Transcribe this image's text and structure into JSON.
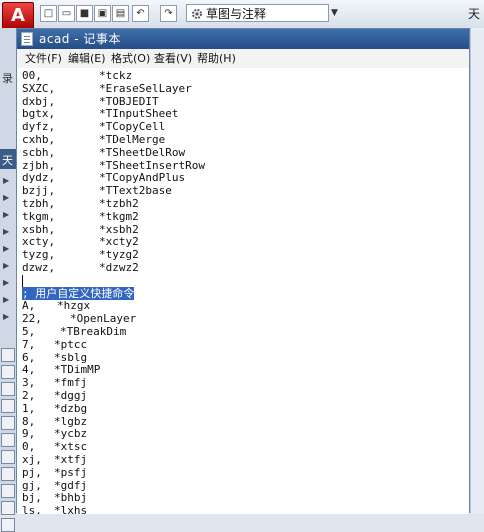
{
  "acad": {
    "logo": "A",
    "workspace": "草图与注释",
    "title_right": "天",
    "left_labels": [
      "录",
      "天"
    ]
  },
  "notepad": {
    "title": "acad - 记事本",
    "menu": [
      "文件(F)",
      "编辑(E)",
      "格式(O)",
      "查看(V)",
      "帮助(H)"
    ],
    "section1": [
      {
        "alias": "00,",
        "cmd": "*tckz"
      },
      {
        "alias": "SXZC,",
        "cmd": "*EraseSelLayer"
      },
      {
        "alias": "dxbj,",
        "cmd": "*TOBJEDIT"
      },
      {
        "alias": "bgtx,",
        "cmd": "*TInputSheet"
      },
      {
        "alias": "dyfz,",
        "cmd": "*TCopyCell"
      },
      {
        "alias": "cxhb,",
        "cmd": "*TDelMerge"
      },
      {
        "alias": "scbh,",
        "cmd": "*TSheetDelRow"
      },
      {
        "alias": "zjbh,",
        "cmd": "*TSheetInsertRow"
      },
      {
        "alias": "dydz,",
        "cmd": "*TCopyAndPlus"
      },
      {
        "alias": "bzjj,",
        "cmd": "*TText2base"
      },
      {
        "alias": "tzbh,",
        "cmd": "*tzbh2"
      },
      {
        "alias": "tkgm,",
        "cmd": "*tkgm2"
      },
      {
        "alias": "xsbh,",
        "cmd": "*xsbh2"
      },
      {
        "alias": "xcty,",
        "cmd": "*xcty2"
      },
      {
        "alias": "tyzg,",
        "cmd": "*tyzg2"
      },
      {
        "alias": "dzwz,",
        "cmd": "*dzwz2"
      }
    ],
    "comment": "; 用户自定义快捷命令",
    "section2": [
      {
        "alias": "A,",
        "cmd": "*hzgx"
      },
      {
        "alias": "22,",
        "cmd": "*OpenLayer"
      },
      {
        "alias": "5,",
        "cmd": "*TBreakDim"
      },
      {
        "alias": "7,",
        "cmd": "*ptcc"
      },
      {
        "alias": "6,",
        "cmd": "*sblg"
      },
      {
        "alias": "4,",
        "cmd": "*TDimMP"
      },
      {
        "alias": "3,",
        "cmd": "*fmfj"
      },
      {
        "alias": "2,",
        "cmd": "*dggj"
      },
      {
        "alias": "1,",
        "cmd": "*dzbg"
      },
      {
        "alias": "8,",
        "cmd": "*lgbz"
      },
      {
        "alias": "9,",
        "cmd": "*ycbz"
      },
      {
        "alias": "0,",
        "cmd": "*xtsc"
      },
      {
        "alias": "xj,",
        "cmd": "*xtfj"
      },
      {
        "alias": "pj,",
        "cmd": "*psfj"
      },
      {
        "alias": "gj,",
        "cmd": "*gdfj"
      },
      {
        "alias": "bj,",
        "cmd": "*bhbj"
      },
      {
        "alias": "ls,",
        "cmd": "*lxhs"
      }
    ]
  }
}
